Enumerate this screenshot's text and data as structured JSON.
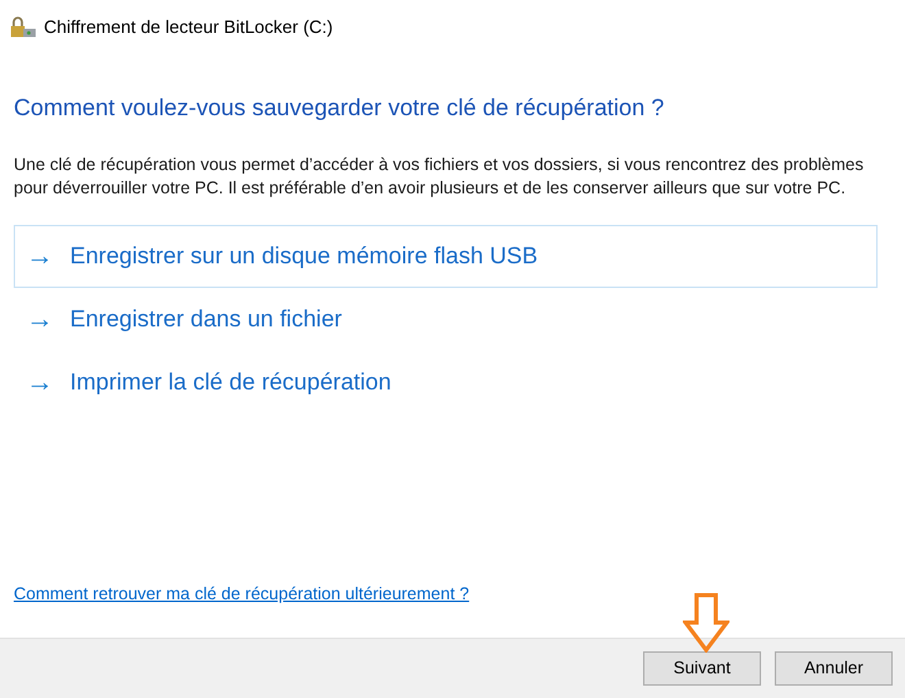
{
  "window": {
    "title": "Chiffrement de lecteur BitLocker (C:)"
  },
  "heading": "Comment voulez-vous sauvegarder votre clé de récupération ?",
  "description": "Une clé de récupération vous permet d’accéder à vos fichiers et vos dossiers, si vous rencontrez des problèmes pour déverrouiller votre PC. Il est préférable d’en avoir plusieurs et de les conserver ailleurs que sur votre PC.",
  "options": [
    {
      "arrow": "→",
      "label": "Enregistrer sur un disque mémoire flash USB",
      "selected": true
    },
    {
      "arrow": "→",
      "label": "Enregistrer dans un fichier",
      "selected": false
    },
    {
      "arrow": "→",
      "label": "Imprimer la clé de récupération",
      "selected": false
    }
  ],
  "help_link": "Comment retrouver ma clé de récupération ultérieurement ?",
  "buttons": [
    "Suivant",
    "Annuler"
  ]
}
